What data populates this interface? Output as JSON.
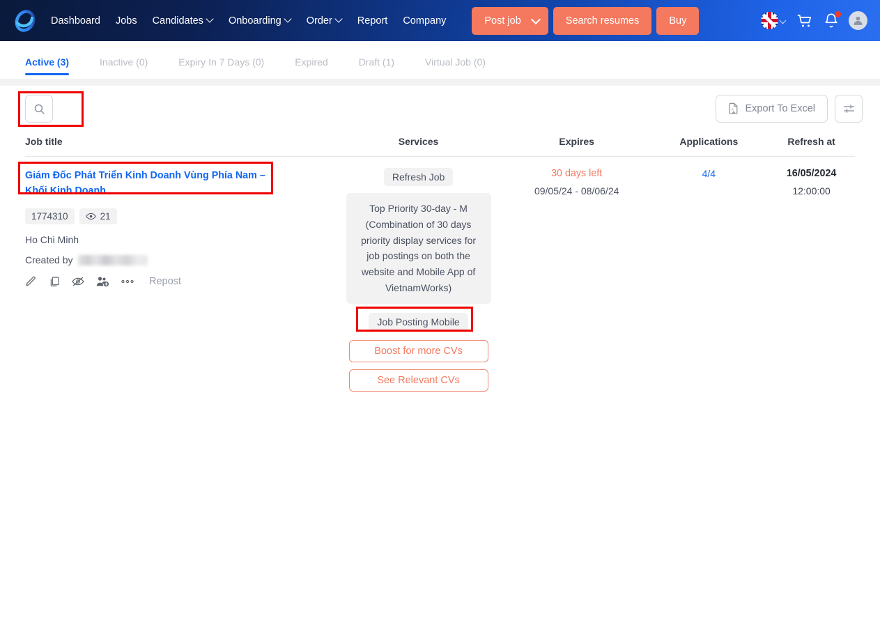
{
  "header": {
    "logo_icon": "vietnamworks-ring-logo",
    "nav": [
      {
        "label": "Dashboard",
        "has_caret": false
      },
      {
        "label": "Jobs",
        "has_caret": false
      },
      {
        "label": "Candidates",
        "has_caret": true
      },
      {
        "label": "Onboarding",
        "has_caret": true
      },
      {
        "label": "Order",
        "has_caret": true
      },
      {
        "label": "Report",
        "has_caret": false
      },
      {
        "label": "Company",
        "has_caret": false
      }
    ],
    "post_job_label": "Post job",
    "search_resumes_label": "Search resumes",
    "buy_label": "Buy",
    "language_flag": "uk-flag-icon",
    "cart_icon": "shopping-cart-icon",
    "notification_icon": "bell-icon",
    "avatar_icon": "user-avatar-icon",
    "accent_color": "#f4795f",
    "brand_blue": "#1266f1"
  },
  "tabs": [
    {
      "label": "Active (3)",
      "active": true
    },
    {
      "label": "Inactive (0)",
      "active": false
    },
    {
      "label": "Expiry In 7 Days (0)",
      "active": false
    },
    {
      "label": "Expired",
      "active": false
    },
    {
      "label": "Draft (1)",
      "active": false
    },
    {
      "label": "Virtual Job (0)",
      "active": false
    }
  ],
  "toolbar": {
    "search_icon": "search-icon",
    "export_label": "Export To Excel",
    "export_icon": "excel-file-icon",
    "filter_icon": "filter-sliders-icon"
  },
  "table": {
    "columns": [
      "Job title",
      "Services",
      "Expires",
      "Applications",
      "Refresh at"
    ],
    "rows": [
      {
        "title": "Giám Đốc Phát Triển Kinh Doanh Vùng Phía Nam – Khối Kinh Doanh",
        "job_id": "1774310",
        "views": "21",
        "views_icon": "eye-icon",
        "location": "Ho Chi Minh",
        "created_by_label": "Created by",
        "created_by_value": "",
        "actions": [
          {
            "icon": "pencil-edit-icon"
          },
          {
            "icon": "copy-duplicate-icon"
          },
          {
            "icon": "eye-off-icon"
          },
          {
            "icon": "add-candidate-icon"
          },
          {
            "icon": "more-dots-icon"
          }
        ],
        "repost_label": "Repost",
        "services": {
          "refresh_chip": "Refresh Job",
          "package": "Top Priority 30-day - M (Combination of 30 days priority display services for job postings on both the website and Mobile App of VietnamWorks)",
          "mobile_chip": "Job Posting Mobile",
          "boost_label": "Boost for more CVs",
          "relevant_label": "See Relevant CVs"
        },
        "expires_primary": "30 days left",
        "expires_range": "09/05/24 - 08/06/24",
        "applications": "4/4",
        "refresh_date": "16/05/2024",
        "refresh_time": "12:00:00"
      }
    ]
  },
  "annotations": {
    "box_color": "#ef0000",
    "boxes": [
      "active-tab",
      "job-title-link",
      "job-posting-mobile-chip"
    ]
  }
}
